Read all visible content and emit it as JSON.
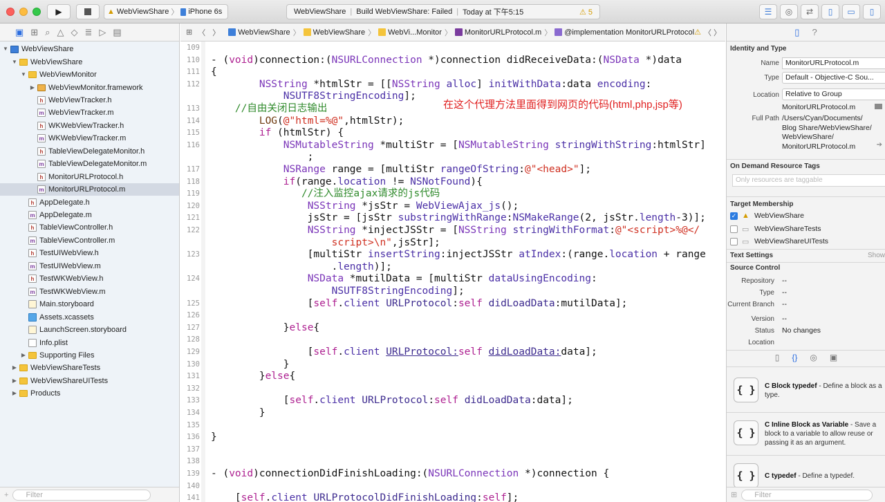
{
  "toolbar": {
    "scheme_target": "WebViewShare",
    "scheme_device": "iPhone 6s",
    "activity_project": "WebViewShare",
    "activity_status": "Build WebViewShare: Failed",
    "activity_time": "Today at 下午5:15",
    "warning_count": "5"
  },
  "navigator": {
    "filter_placeholder": "Filter",
    "items": [
      {
        "label": "WebViewShare",
        "icon": "proj",
        "depth": 0,
        "disc": "▼"
      },
      {
        "label": "WebViewShare",
        "icon": "folder",
        "depth": 1,
        "disc": "▼"
      },
      {
        "label": "WebViewMonitor",
        "icon": "folder",
        "depth": 2,
        "disc": "▼"
      },
      {
        "label": "WebViewMonitor.framework",
        "icon": "fw",
        "depth": 3,
        "disc": "▶"
      },
      {
        "label": "WebViewTracker.h",
        "icon": "h",
        "depth": 3,
        "disc": ""
      },
      {
        "label": "WebViewTracker.m",
        "icon": "m",
        "depth": 3,
        "disc": ""
      },
      {
        "label": "WKWebViewTracker.h",
        "icon": "h",
        "depth": 3,
        "disc": ""
      },
      {
        "label": "WKWebViewTracker.m",
        "icon": "m",
        "depth": 3,
        "disc": ""
      },
      {
        "label": "TableViewDelegateMonitor.h",
        "icon": "h",
        "depth": 3,
        "disc": ""
      },
      {
        "label": "TableViewDelegateMonitor.m",
        "icon": "m",
        "depth": 3,
        "disc": ""
      },
      {
        "label": "MonitorURLProtocol.h",
        "icon": "h",
        "depth": 3,
        "disc": ""
      },
      {
        "label": "MonitorURLProtocol.m",
        "icon": "m",
        "depth": 3,
        "disc": "",
        "selected": true
      },
      {
        "label": "AppDelegate.h",
        "icon": "h",
        "depth": 2,
        "disc": ""
      },
      {
        "label": "AppDelegate.m",
        "icon": "m",
        "depth": 2,
        "disc": ""
      },
      {
        "label": "TableViewController.h",
        "icon": "h",
        "depth": 2,
        "disc": ""
      },
      {
        "label": "TableViewController.m",
        "icon": "m",
        "depth": 2,
        "disc": ""
      },
      {
        "label": "TestUIWebView.h",
        "icon": "h",
        "depth": 2,
        "disc": ""
      },
      {
        "label": "TestUIWebView.m",
        "icon": "m",
        "depth": 2,
        "disc": ""
      },
      {
        "label": "TestWKWebView.h",
        "icon": "h",
        "depth": 2,
        "disc": ""
      },
      {
        "label": "TestWKWebView.m",
        "icon": "m",
        "depth": 2,
        "disc": ""
      },
      {
        "label": "Main.storyboard",
        "icon": "sb",
        "depth": 2,
        "disc": ""
      },
      {
        "label": "Assets.xcassets",
        "icon": "xc",
        "depth": 2,
        "disc": ""
      },
      {
        "label": "LaunchScreen.storyboard",
        "icon": "sb",
        "depth": 2,
        "disc": ""
      },
      {
        "label": "Info.plist",
        "icon": "pl",
        "depth": 2,
        "disc": ""
      },
      {
        "label": "Supporting Files",
        "icon": "folder",
        "depth": 2,
        "disc": "▶"
      },
      {
        "label": "WebViewShareTests",
        "icon": "folder",
        "depth": 1,
        "disc": "▶"
      },
      {
        "label": "WebViewShareUITests",
        "icon": "folder",
        "depth": 1,
        "disc": "▶"
      },
      {
        "label": "Products",
        "icon": "folder",
        "depth": 1,
        "disc": "▶"
      }
    ]
  },
  "jumpbar": {
    "crumbs": [
      "WebViewShare",
      "WebViewShare",
      "WebVi...Monitor",
      "MonitorURLProtocol.m",
      "@implementation MonitorURLProtocol"
    ]
  },
  "editor": {
    "annotation": "在这个代理方法里面得到网页的代码(html,php,jsp等)",
    "lines": [
      {
        "n": "109",
        "segs": []
      },
      {
        "n": "110",
        "segs": [
          [
            "- (",
            ""
          ],
          [
            "void",
            "kw"
          ],
          [
            ")connection:(",
            ""
          ],
          [
            "NSURLConnection",
            "ty"
          ],
          [
            " *)connection didReceiveData:(",
            ""
          ],
          [
            "NSData",
            "ty"
          ],
          [
            " *)data",
            ""
          ]
        ]
      },
      {
        "n": "111",
        "segs": [
          [
            "{",
            ""
          ]
        ]
      },
      {
        "n": "112",
        "segs": [
          [
            "        ",
            ""
          ],
          [
            "NSString",
            "ty"
          ],
          [
            " *htmlStr = [[",
            ""
          ],
          [
            "NSString",
            "ty"
          ],
          [
            " ",
            ""
          ],
          [
            "alloc",
            "cls"
          ],
          [
            "] ",
            ""
          ],
          [
            "initWithData",
            "cls"
          ],
          [
            ":data ",
            ""
          ],
          [
            "encoding",
            "cls"
          ],
          [
            ":",
            ""
          ]
        ]
      },
      {
        "n": "",
        "segs": [
          [
            "            ",
            ""
          ],
          [
            "NSUTF8StringEncoding",
            "cls"
          ],
          [
            "];",
            ""
          ]
        ]
      },
      {
        "n": "113",
        "segs": [
          [
            "    ",
            ""
          ],
          [
            "//自由关闭日志输出",
            "cm"
          ]
        ]
      },
      {
        "n": "114",
        "segs": [
          [
            "        ",
            ""
          ],
          [
            "LOG",
            "mc"
          ],
          [
            "(",
            ""
          ],
          [
            "@\"html=%@\"",
            "st"
          ],
          [
            ",htmlStr);",
            ""
          ]
        ]
      },
      {
        "n": "115",
        "segs": [
          [
            "        ",
            ""
          ],
          [
            "if",
            "kw"
          ],
          [
            " (htmlStr) {",
            ""
          ]
        ]
      },
      {
        "n": "116",
        "segs": [
          [
            "            ",
            ""
          ],
          [
            "NSMutableString",
            "ty"
          ],
          [
            " *multiStr = [",
            ""
          ],
          [
            "NSMutableString",
            "ty"
          ],
          [
            " ",
            ""
          ],
          [
            "stringWithString",
            "cls"
          ],
          [
            ":htmlStr]",
            ""
          ]
        ]
      },
      {
        "n": "",
        "segs": [
          [
            "                ;",
            ""
          ]
        ]
      },
      {
        "n": "117",
        "segs": [
          [
            "            ",
            ""
          ],
          [
            "NSRange",
            "ty"
          ],
          [
            " range = [multiStr ",
            ""
          ],
          [
            "rangeOfString",
            "cls"
          ],
          [
            ":",
            ""
          ],
          [
            "@\"<head>\"",
            "st"
          ],
          [
            "];",
            ""
          ]
        ]
      },
      {
        "n": "118",
        "segs": [
          [
            "            ",
            ""
          ],
          [
            "if",
            "kw"
          ],
          [
            "(range.",
            ""
          ],
          [
            "location",
            "cls"
          ],
          [
            " != ",
            ""
          ],
          [
            "NSNotFound",
            "cls"
          ],
          [
            "){",
            ""
          ]
        ]
      },
      {
        "n": "119",
        "segs": [
          [
            "               ",
            ""
          ],
          [
            "//注入监控ajax请求的js代码",
            "cm"
          ]
        ]
      },
      {
        "n": "120",
        "segs": [
          [
            "                ",
            ""
          ],
          [
            "NSString",
            "ty"
          ],
          [
            " *jsStr = ",
            ""
          ],
          [
            "WebViewAjax_js",
            "cls"
          ],
          [
            "();",
            ""
          ]
        ]
      },
      {
        "n": "121",
        "segs": [
          [
            "                jsStr = [jsStr ",
            ""
          ],
          [
            "substringWithRange",
            "cls"
          ],
          [
            ":",
            ""
          ],
          [
            "NSMakeRange",
            "cls"
          ],
          [
            "(2, jsStr.",
            ""
          ],
          [
            "length",
            "cls"
          ],
          [
            "-3)];",
            ""
          ]
        ]
      },
      {
        "n": "122",
        "segs": [
          [
            "                ",
            ""
          ],
          [
            "NSString",
            "ty"
          ],
          [
            " *injectJSStr = [",
            ""
          ],
          [
            "NSString",
            "ty"
          ],
          [
            " ",
            ""
          ],
          [
            "stringWithFormat",
            "cls"
          ],
          [
            ":",
            ""
          ],
          [
            "@\"<script>%@</",
            "st"
          ]
        ]
      },
      {
        "n": "",
        "segs": [
          [
            "                    ",
            ""
          ],
          [
            "script>\\n\"",
            "st"
          ],
          [
            ",jsStr];",
            ""
          ]
        ]
      },
      {
        "n": "123",
        "segs": [
          [
            "                [multiStr ",
            ""
          ],
          [
            "insertString",
            "cls"
          ],
          [
            ":injectJSStr ",
            ""
          ],
          [
            "atIndex",
            "cls"
          ],
          [
            ":(range.",
            ""
          ],
          [
            "location",
            "cls"
          ],
          [
            " + range",
            ""
          ]
        ]
      },
      {
        "n": "",
        "segs": [
          [
            "                    .",
            ""
          ],
          [
            "length",
            "cls"
          ],
          [
            ")];",
            ""
          ]
        ]
      },
      {
        "n": "124",
        "segs": [
          [
            "                ",
            ""
          ],
          [
            "NSData",
            "ty"
          ],
          [
            " *mutilData = [multiStr ",
            ""
          ],
          [
            "dataUsingEncoding",
            "cls"
          ],
          [
            ":",
            ""
          ]
        ]
      },
      {
        "n": "",
        "segs": [
          [
            "                    ",
            ""
          ],
          [
            "NSUTF8StringEncoding",
            "cls"
          ],
          [
            "];",
            ""
          ]
        ]
      },
      {
        "n": "125",
        "segs": [
          [
            "                [",
            ""
          ],
          [
            "self",
            "kw"
          ],
          [
            ".",
            ""
          ],
          [
            "client",
            "cls"
          ],
          [
            " ",
            ""
          ],
          [
            "URLProtocol",
            "me"
          ],
          [
            ":",
            ""
          ],
          [
            "self",
            "kw"
          ],
          [
            " ",
            ""
          ],
          [
            "didLoadData",
            "me"
          ],
          [
            ":mutilData];",
            ""
          ]
        ]
      },
      {
        "n": "126",
        "segs": []
      },
      {
        "n": "127",
        "segs": [
          [
            "            }",
            ""
          ],
          [
            "else",
            "kw"
          ],
          [
            "{",
            ""
          ]
        ]
      },
      {
        "n": "128",
        "segs": []
      },
      {
        "n": "129",
        "segs": [
          [
            "                [",
            ""
          ],
          [
            "self",
            "kw"
          ],
          [
            ".",
            ""
          ],
          [
            "client",
            "cls"
          ],
          [
            " ",
            ""
          ],
          [
            "URLProtocol:",
            "me un"
          ],
          [
            "self",
            "kw"
          ],
          [
            " ",
            ""
          ],
          [
            "didLoadData:",
            "me un"
          ],
          [
            "data];",
            ""
          ]
        ]
      },
      {
        "n": "130",
        "segs": [
          [
            "            }",
            ""
          ]
        ]
      },
      {
        "n": "131",
        "segs": [
          [
            "        }",
            ""
          ],
          [
            "else",
            "kw"
          ],
          [
            "{",
            ""
          ]
        ]
      },
      {
        "n": "132",
        "segs": []
      },
      {
        "n": "133",
        "segs": [
          [
            "            [",
            ""
          ],
          [
            "self",
            "kw"
          ],
          [
            ".",
            ""
          ],
          [
            "client",
            "cls"
          ],
          [
            " ",
            ""
          ],
          [
            "URLProtocol",
            "me"
          ],
          [
            ":",
            ""
          ],
          [
            "self",
            "kw"
          ],
          [
            " ",
            ""
          ],
          [
            "didLoadData",
            "me"
          ],
          [
            ":data];",
            ""
          ]
        ]
      },
      {
        "n": "134",
        "segs": [
          [
            "        }",
            ""
          ]
        ]
      },
      {
        "n": "135",
        "segs": []
      },
      {
        "n": "136",
        "segs": [
          [
            "}",
            ""
          ]
        ]
      },
      {
        "n": "137",
        "segs": []
      },
      {
        "n": "138",
        "segs": []
      },
      {
        "n": "139",
        "segs": [
          [
            "- (",
            ""
          ],
          [
            "void",
            "kw"
          ],
          [
            ")connectionDidFinishLoading:(",
            ""
          ],
          [
            "NSURLConnection",
            "ty"
          ],
          [
            " *)connection {",
            ""
          ]
        ]
      },
      {
        "n": "140",
        "segs": []
      },
      {
        "n": "141",
        "segs": [
          [
            "    [",
            ""
          ],
          [
            "self",
            "kw"
          ],
          [
            ".",
            ""
          ],
          [
            "client",
            "cls"
          ],
          [
            " ",
            ""
          ],
          [
            "URLProtocolDidFinishLoading",
            "me"
          ],
          [
            ":",
            ""
          ],
          [
            "self",
            "kw"
          ],
          [
            "];",
            ""
          ]
        ]
      }
    ]
  },
  "inspector": {
    "identity_type_header": "Identity and Type",
    "name_label": "Name",
    "name_value": "MonitorURLProtocol.m",
    "type_label": "Type",
    "type_value": "Default - Objective-C Sou...",
    "location_label": "Location",
    "location_value": "Relative to Group",
    "location_file": "MonitorURLProtocol.m",
    "fullpath_label": "Full Path",
    "fullpath_lines": [
      "/Users/Cyan/Documents/",
      "Blog Share/WebViewShare/",
      "WebViewShare/",
      "MonitorURLProtocol.m"
    ],
    "ondemand_header": "On Demand Resource Tags",
    "ondemand_placeholder": "Only resources are taggable",
    "target_header": "Target Membership",
    "targets": [
      {
        "name": "WebViewShare",
        "checked": true
      },
      {
        "name": "WebViewShareTests",
        "checked": false
      },
      {
        "name": "WebViewShareUITests",
        "checked": false
      }
    ],
    "text_settings_header": "Text Settings",
    "text_settings_show": "Show",
    "source_control_header": "Source Control",
    "repository_label": "Repository",
    "repository_value": "--",
    "sc_type_label": "Type",
    "sc_type_value": "--",
    "branch_label": "Current Branch",
    "branch_value": "--",
    "version_label": "Version",
    "version_value": "--",
    "status_label": "Status",
    "status_value": "No changes",
    "sc_location_label": "Location",
    "library": [
      {
        "title": "C Block typedef",
        "desc": " - Define a block as a type."
      },
      {
        "title": "C Inline Block as Variable",
        "desc": " - Save a block to a variable to allow reuse or passing it as an argument."
      },
      {
        "title": "C typedef",
        "desc": " - Define a typedef."
      }
    ],
    "filter_placeholder": "Filter"
  }
}
